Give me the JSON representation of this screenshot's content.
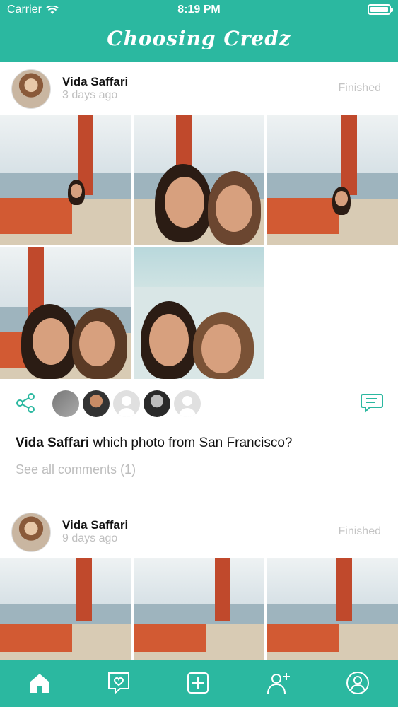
{
  "status_bar": {
    "carrier": "Carrier",
    "time": "8:19 PM"
  },
  "app": {
    "title": "Choosing Credz"
  },
  "posts": [
    {
      "username": "Vida Saffari",
      "time_ago": "3 days ago",
      "status": "Finished",
      "caption_user": "Vida Saffari",
      "caption_text": " which photo from San Francisco?",
      "see_all": "See all comments (1)"
    },
    {
      "username": "Vida Saffari",
      "time_ago": "9 days ago",
      "status": "Finished"
    }
  ],
  "icons": {
    "share": "share-icon",
    "comment": "comment-icon",
    "home": "home-icon",
    "heart_chat": "heart-chat-icon",
    "add": "add-icon",
    "add_user": "add-user-icon",
    "profile": "profile-icon"
  },
  "colors": {
    "accent": "#2bb8a0"
  }
}
